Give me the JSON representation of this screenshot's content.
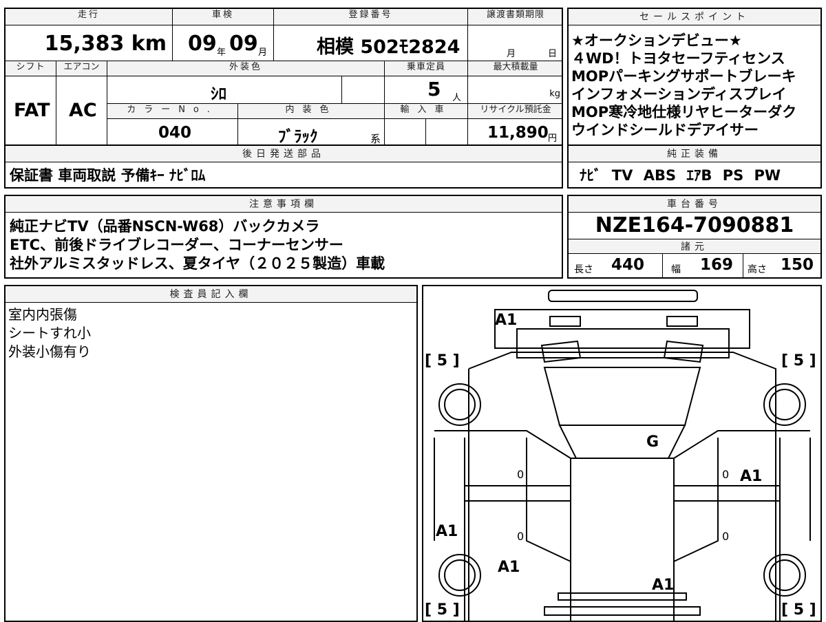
{
  "top_left": {
    "headers": {
      "mileage": "走行",
      "inspection": "車検",
      "registration": "登録番号",
      "transfer": "譲渡書類期限"
    },
    "mileage": "15,383 km",
    "inspection_year": "09",
    "year_unit": "年",
    "inspection_month": "09",
    "month_unit": "月",
    "registration": "相模 502ﾓ2824",
    "transfer_month": "月",
    "transfer_day": "日",
    "labels": {
      "shift": "シフト",
      "aircon": "エアコン",
      "exterior": "外装色",
      "capacity": "乗車定員",
      "load": "最大積載量",
      "color_no": "カラーNo.",
      "interior": "内装色",
      "import": "輸入車",
      "recycle": "リサイクル預託金"
    },
    "shift": "FAT",
    "aircon": "AC",
    "exterior_color": "ｼﾛ",
    "capacity": "5",
    "capacity_unit": "人",
    "load_unit": "kg",
    "color_no": "040",
    "interior_color": "ﾌﾞﾗｯｸ",
    "interior_suffix": "系",
    "recycle": "11,890",
    "recycle_unit": "円"
  },
  "sales_points": {
    "header": "セールスポイント",
    "lines": [
      "★オークションデビュー★",
      "４WD！トヨタセーフティセンス",
      "MOPパーキングサポートブレーキ",
      "インフォメーションディスプレイ",
      "MOP寒冷地仕様リヤヒーターダク",
      "ウインドシールドデアイサー"
    ]
  },
  "later_parts": {
    "header": "後日発送部品",
    "text": "保証書 車両取説 予備ｷｰ ﾅﾋﾞﾛﾑ"
  },
  "genuine": {
    "header": "純正装備",
    "text": "ﾅﾋﾞ TV ABS ｴｱB PS PW"
  },
  "caution": {
    "header": "注意事項欄",
    "lines": [
      "純正ナビTV（品番NSCN-W68）バックカメラ",
      "ETC、前後ドライブレコーダー、コーナーセンサー",
      "社外アルミスタッドレス、夏タイヤ（２０２５製造）車載"
    ]
  },
  "chassis": {
    "header": "車台番号",
    "number": "NZE164-7090881"
  },
  "specs": {
    "header": "諸元",
    "length_label": "長さ",
    "length": "440",
    "width_label": "幅",
    "width": "169",
    "height_label": "高さ",
    "height": "150"
  },
  "inspector": {
    "header": "検査員記入欄",
    "lines": [
      "室内内張傷",
      "シートすれ小",
      "外装小傷有り"
    ]
  },
  "diagram": {
    "marks": {
      "front_bumper": "A1",
      "hood": "G",
      "rf_fender": "A1",
      "lf_fender": "A1",
      "lr_door": "A1",
      "roof_rear": "A1"
    },
    "tread": {
      "fl": "[ 5 ]",
      "fr": "[ 5 ]",
      "rl": "[ 5 ]",
      "rr": "[ 5 ]"
    },
    "zeros": [
      "0",
      "0",
      "0",
      "0"
    ]
  }
}
